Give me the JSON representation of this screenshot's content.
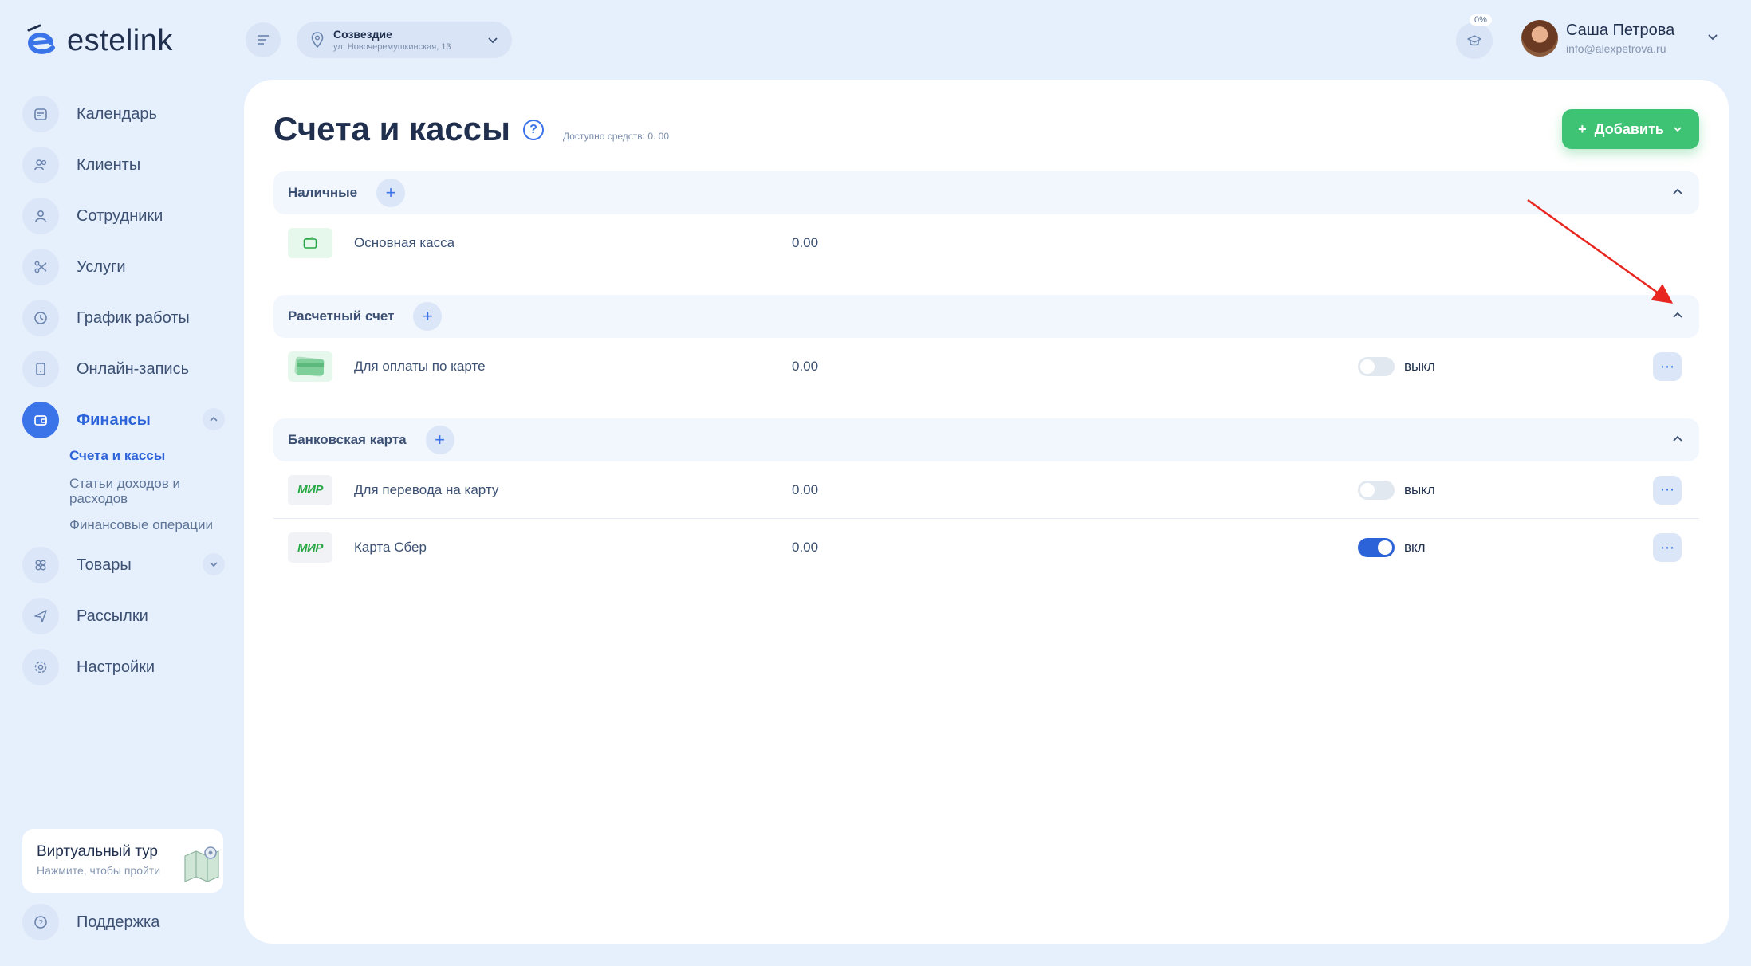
{
  "app": {
    "logo_text": "estelink"
  },
  "sidebar": {
    "items": [
      {
        "label": "Календарь",
        "icon": "calendar-icon"
      },
      {
        "label": "Клиенты",
        "icon": "clients-icon"
      },
      {
        "label": "Сотрудники",
        "icon": "staff-icon"
      },
      {
        "label": "Услуги",
        "icon": "scissors-icon"
      },
      {
        "label": "График работы",
        "icon": "clock-icon"
      },
      {
        "label": "Онлайн-запись",
        "icon": "phone-icon"
      },
      {
        "label": "Финансы",
        "icon": "wallet-icon"
      },
      {
        "label": "Товары",
        "icon": "goods-icon"
      },
      {
        "label": "Рассылки",
        "icon": "send-icon"
      },
      {
        "label": "Настройки",
        "icon": "gear-icon"
      }
    ],
    "finance_sub": [
      "Счета и кассы",
      "Статьи доходов и расходов",
      "Финансовые операции"
    ],
    "tour_title": "Виртуальный тур",
    "tour_sub": "Нажмите, чтобы пройти",
    "support": "Поддержка"
  },
  "topbar": {
    "location_name": "Созвездие",
    "location_address": "ул. Новочеремушкинская, 13",
    "progress": "0%",
    "user_name": "Саша Петрова",
    "user_email": "info@alexpetrova.ru"
  },
  "main": {
    "title": "Счета и кассы",
    "available": "Доступно средств: 0. 00",
    "add_label": "Добавить"
  },
  "sections": [
    {
      "title": "Наличные",
      "rows": [
        {
          "name": "Основная касса",
          "amount": "0.00"
        }
      ]
    },
    {
      "title": "Расчетный счет",
      "rows": [
        {
          "name": "Для оплаты по карте",
          "amount": "0.00",
          "toggle": "выкл"
        }
      ]
    },
    {
      "title": "Банковская карта",
      "rows": [
        {
          "name": "Для перевода на карту",
          "amount": "0.00",
          "toggle": "выкл",
          "badge": "МИР"
        },
        {
          "name": "Карта Сбер",
          "amount": "0.00",
          "toggle": "вкл",
          "badge": "МИР"
        }
      ]
    }
  ],
  "colors": {
    "accent": "#3b73e8",
    "add_button": "#3ec273",
    "annotation_arrow": "#e8261f"
  }
}
